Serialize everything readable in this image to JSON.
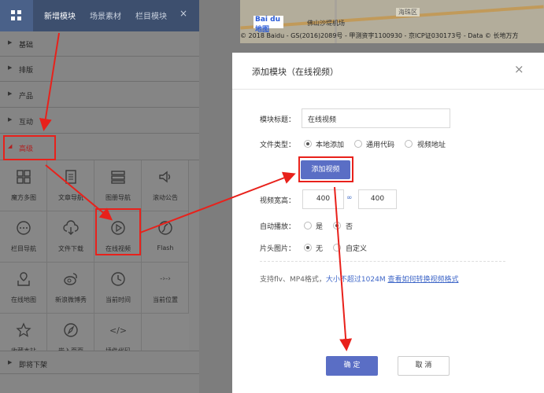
{
  "left_panel": {
    "tabs": [
      "新增模块",
      "场景素材",
      "栏目模块"
    ],
    "close_icon": "×",
    "categories": [
      "基础",
      "排版",
      "产品",
      "互动",
      "高级",
      "即将下架"
    ],
    "modules": [
      {
        "label": "魔方多图",
        "icon": "cube-grid-icon"
      },
      {
        "label": "文章导航",
        "icon": "document-list-icon"
      },
      {
        "label": "图册导航",
        "icon": "album-icon"
      },
      {
        "label": "滚动公告",
        "icon": "speaker-icon"
      },
      {
        "label": "栏目导航",
        "icon": "chat-dots-icon"
      },
      {
        "label": "文件下载",
        "icon": "cloud-download-icon"
      },
      {
        "label": "在线视频",
        "icon": "play-circle-icon"
      },
      {
        "label": "Flash",
        "icon": "flash-icon"
      },
      {
        "label": "在线地图",
        "icon": "map-pin-icon"
      },
      {
        "label": "新浪微博秀",
        "icon": "weibo-icon"
      },
      {
        "label": "当前时间",
        "icon": "clock-icon"
      },
      {
        "label": "当前位置",
        "icon": "breadcrumb-arrows-icon"
      },
      {
        "label": "收藏本站",
        "icon": "star-icon"
      },
      {
        "label": "嵌入页面",
        "icon": "compass-icon"
      },
      {
        "label": "插件代码",
        "icon": "code-icon"
      }
    ]
  },
  "map": {
    "logo": "Bai du 地图",
    "copyright": "© 2018 Baidu - GS(2016)2089号 - 甲测资字1100930 - 京ICP证030173号 - Data © 长地万方",
    "district": "海珠区",
    "place": "佛山沙堤机场"
  },
  "dialog": {
    "title": "添加模块（在线视频）",
    "close_icon": "×",
    "module_title_label": "模块标题：",
    "module_title_value": "在线视频",
    "file_type_label": "文件类型：",
    "file_type_options": [
      "本地添加",
      "通用代码",
      "视频地址"
    ],
    "add_video_button": "添加视频",
    "size_label": "视频宽高：",
    "width_value": "400",
    "height_value": "400",
    "link_icon": "∞",
    "autoplay_label": "自动播放：",
    "autoplay_options": [
      "是",
      "否"
    ],
    "cover_label": "片头图片：",
    "cover_options": [
      "无",
      "自定义"
    ],
    "hint_prefix": "支持flv、MP4格式，",
    "hint_size": "大小不超过1024M",
    "hint_link": "查看如何转换视频格式",
    "ok_button": "确 定",
    "cancel_button": "取 消"
  },
  "annotation_color": "#e8211b"
}
